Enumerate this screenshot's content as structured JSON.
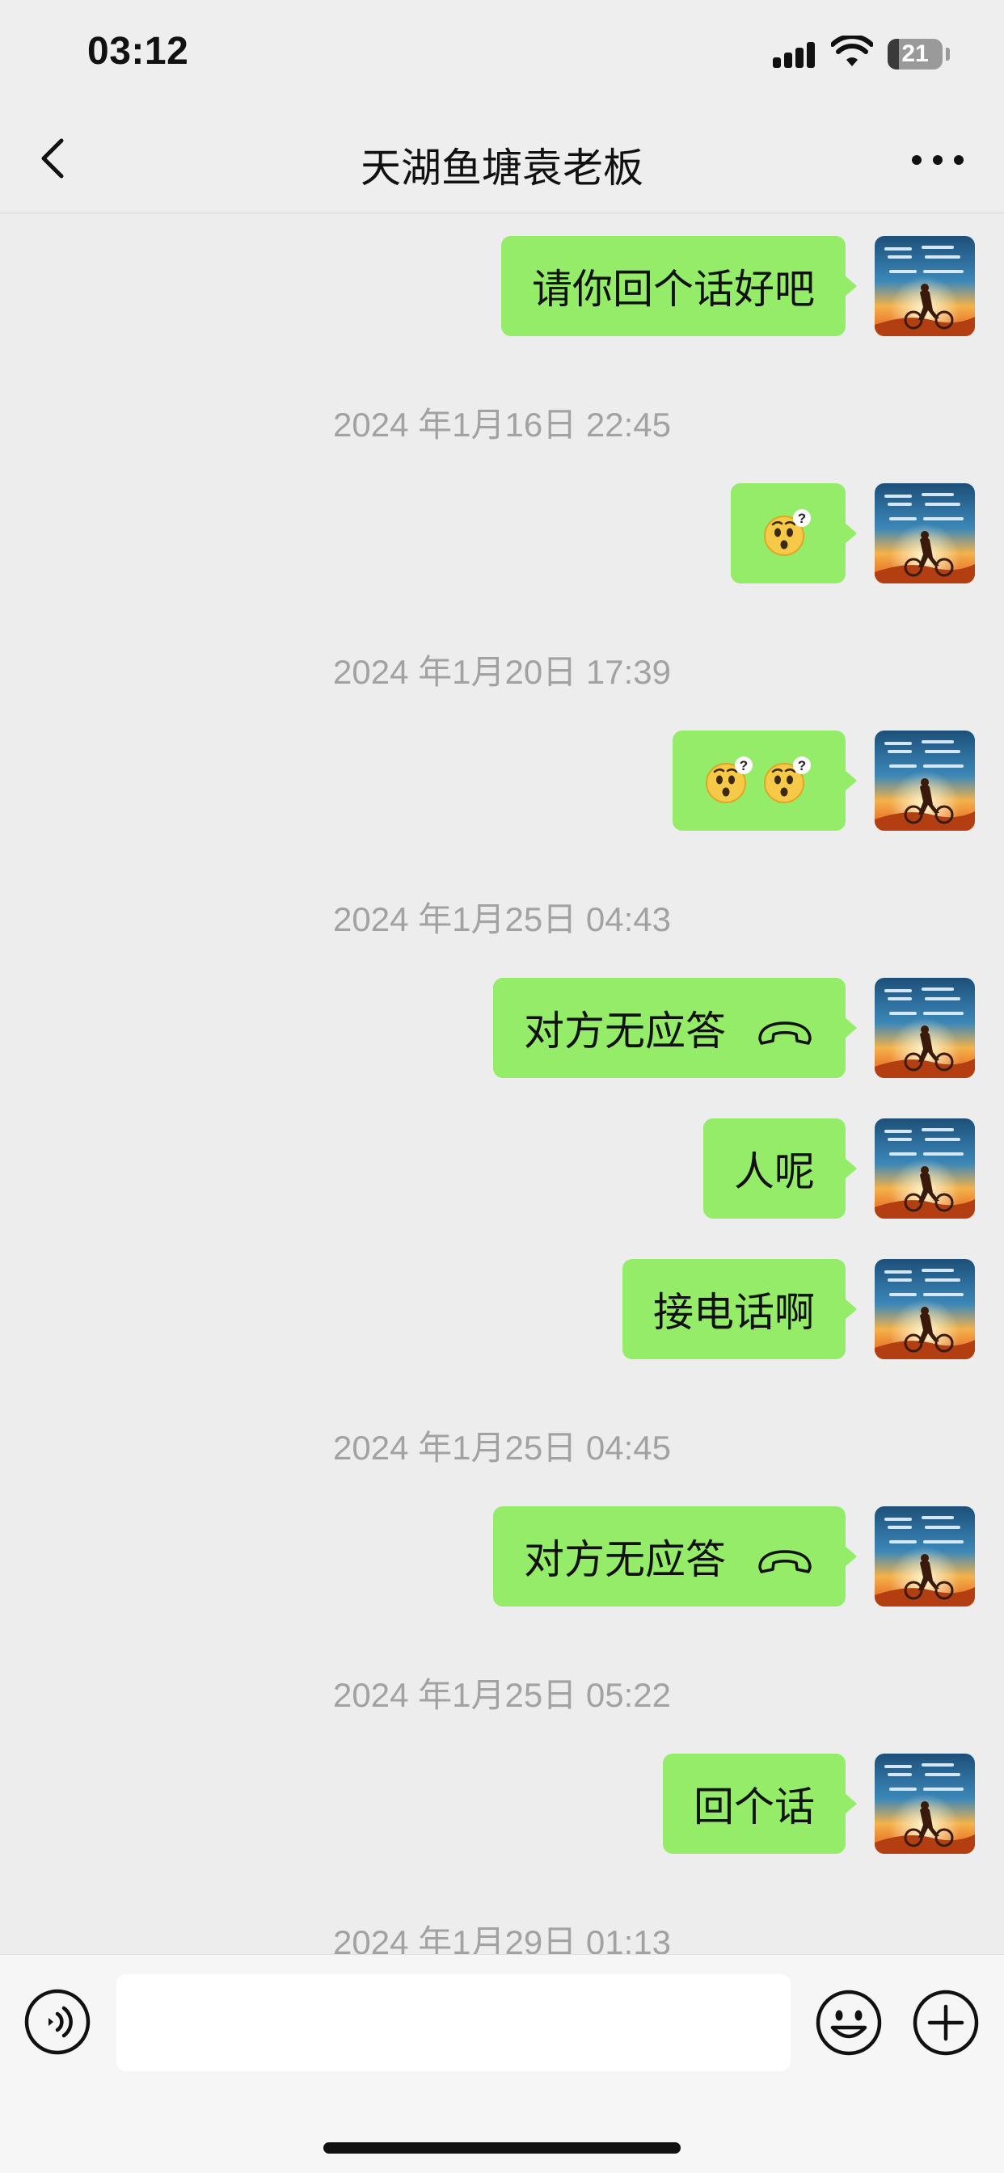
{
  "status_bar": {
    "time": "03:12",
    "battery": "21",
    "battery_level": 0.21
  },
  "nav": {
    "title": "天湖鱼塘袁老板",
    "back_icon": "chevron-left-icon",
    "more_icon": "ellipsis-icon"
  },
  "colors": {
    "bubble_self": "#95ec69",
    "chat_background": "#ededed",
    "timestamp_text": "#a2a2a2"
  },
  "messages": [
    {
      "type": "text",
      "text": "请你回个话好吧"
    },
    {
      "type": "timestamp",
      "text": "2024 年1月16日 22:45"
    },
    {
      "type": "emoji",
      "emoji": "thinking-question-face",
      "count": 1
    },
    {
      "type": "timestamp",
      "text": "2024 年1月20日 17:39"
    },
    {
      "type": "emoji",
      "emoji": "thinking-question-face",
      "count": 2
    },
    {
      "type": "timestamp",
      "text": "2024 年1月25日 04:43"
    },
    {
      "type": "call",
      "text": "对方无应答",
      "icon": "phone-hangup-icon"
    },
    {
      "type": "text",
      "text": "人呢"
    },
    {
      "type": "text",
      "text": "接电话啊"
    },
    {
      "type": "timestamp",
      "text": "2024 年1月25日 04:45"
    },
    {
      "type": "call",
      "text": "对方无应答",
      "icon": "phone-hangup-icon"
    },
    {
      "type": "timestamp",
      "text": "2024 年1月25日 05:22"
    },
    {
      "type": "text",
      "text": "回个话"
    },
    {
      "type": "timestamp",
      "text": "2024 年1月29日 01:13"
    }
  ],
  "avatar": {
    "text": "未来可期 人生值得"
  },
  "input_bar": {
    "placeholder": "",
    "value": "",
    "voice_icon": "voice-icon",
    "emoji_icon": "smiley-icon",
    "plus_icon": "plus-circle-icon"
  }
}
